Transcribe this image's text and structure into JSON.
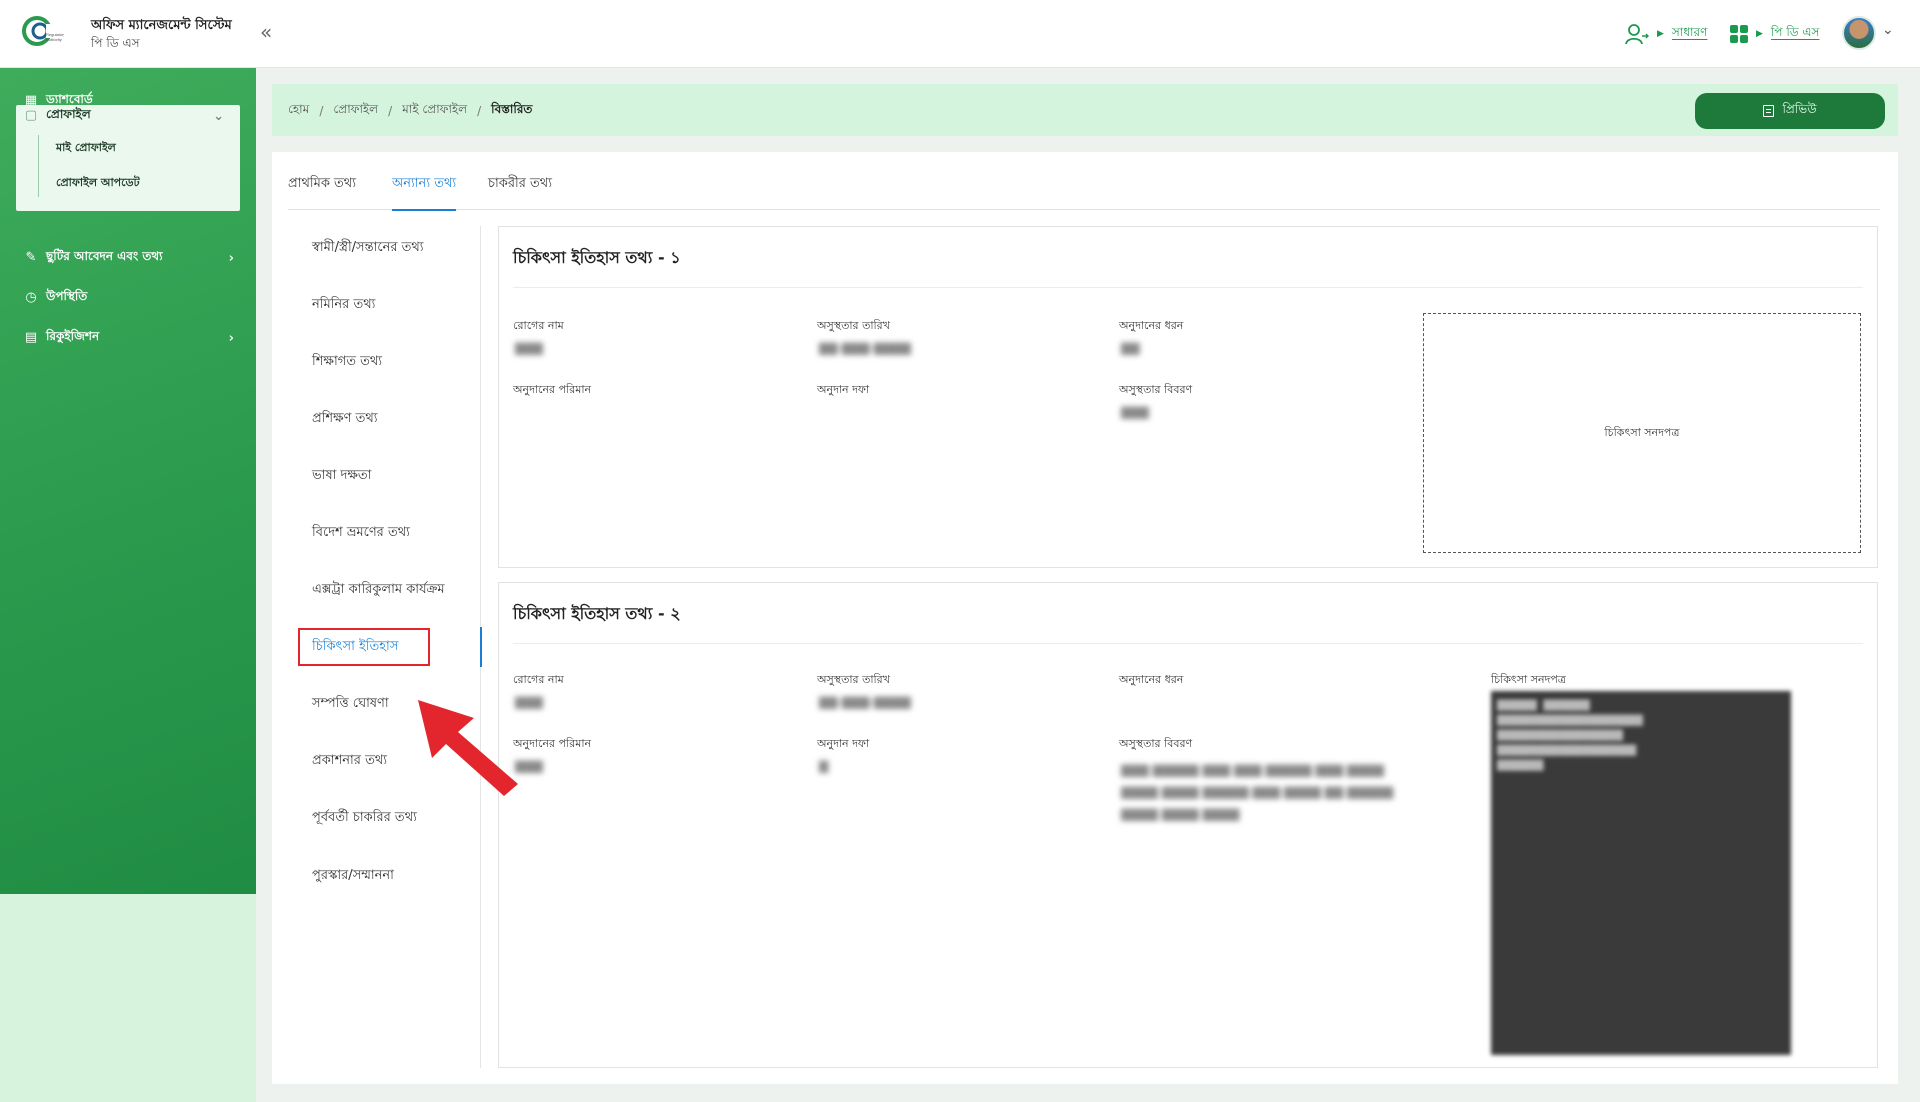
{
  "header": {
    "app_title": "অফিস ম্যানেজমেন্ট সিস্টেম",
    "app_subtitle": "পি ডি এস",
    "role_label": "সাধারণ",
    "app_label": "পি ডি এস"
  },
  "sidebar": {
    "items": [
      {
        "label": "ড্যাশবোর্ড",
        "icon": "dashboard-icon"
      },
      {
        "label": "প্রোফাইল",
        "icon": "profile-icon"
      },
      {
        "label": "ছুটির আবেদন এবং তথ্য",
        "icon": "leave-icon"
      },
      {
        "label": "উপস্থিতি",
        "icon": "clock-icon"
      },
      {
        "label": "রিকুইজিশন",
        "icon": "requisition-icon"
      }
    ],
    "profile_sub": [
      {
        "label": "মাই প্রোফাইল"
      },
      {
        "label": "প্রোফাইল আপডেট"
      }
    ]
  },
  "breadcrumb": {
    "items": [
      "হোম",
      "প্রোফাইল",
      "মাই প্রোফাইল"
    ],
    "current": "বিস্তারিত"
  },
  "preview_button": "প্রিভিউ",
  "tabs": [
    {
      "label": "প্রাথমিক তথ্য"
    },
    {
      "label": "অন্যান্য তথ্য"
    },
    {
      "label": "চাকরীর তথ্য"
    }
  ],
  "side_list": [
    {
      "label": "স্বামী/স্ত্রী/সন্তানের তথ্য"
    },
    {
      "label": "নমিনির তথ্য"
    },
    {
      "label": "শিক্ষাগত তথ্য"
    },
    {
      "label": "প্রশিক্ষণ তথ্য"
    },
    {
      "label": "ভাষা দক্ষতা"
    },
    {
      "label": "বিদেশ ভ্রমণের তথ্য"
    },
    {
      "label": "এক্সট্রা কারিকুলাম কার্যক্রম"
    },
    {
      "label": "চিকিৎসা ইতিহাস"
    },
    {
      "label": "সম্পত্তি ঘোষণা"
    },
    {
      "label": "প্রকাশনার তথ্য"
    },
    {
      "label": "পূর্ববর্তী চাকরির তথ্য"
    },
    {
      "label": "পুরস্কার/সম্মাননা"
    }
  ],
  "records": [
    {
      "title": "চিকিৎসা ইতিহাস তথ্য - ১",
      "labels": {
        "disease": "রোগের নাম",
        "date": "অসুস্থতার তারিখ",
        "grant_type": "অনুদানের ধরন",
        "grant_amount": "অনুদানের পরিমান",
        "grant_section": "অনুদান দফা",
        "details": "অসুস্থতার বিবরণ",
        "certificate": "চিকিৎসা সনদপত্র"
      }
    },
    {
      "title": "চিকিৎসা ইতিহাস তথ্য - ২",
      "labels": {
        "disease": "রোগের নাম",
        "date": "অসুস্থতার তারিখ",
        "grant_type": "অনুদানের ধরন",
        "grant_amount": "অনুদানের পরিমান",
        "grant_section": "অনুদান দফা",
        "details": "অসুস্থতার বিবরণ",
        "certificate": "চিকিৎসা সনদপত্র"
      }
    }
  ],
  "colors": {
    "brand_green": "#1d7a3a",
    "sidebar_green": "#2b9a4d",
    "breadcrumb_bg": "#d4f4dd",
    "active_blue": "#1a7fd4",
    "annotation_red": "#e3262e"
  }
}
